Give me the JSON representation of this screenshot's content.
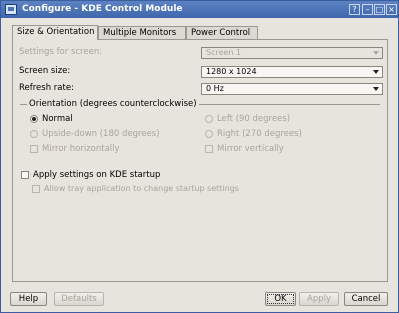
{
  "window": {
    "title": "Configure - KDE Control Module"
  },
  "titlebar_buttons": {
    "help": "?",
    "minimize": "–",
    "maximize": "□",
    "close": "×"
  },
  "tabs": [
    {
      "label": "Size & Orientation"
    },
    {
      "label": "Multiple Monitors"
    },
    {
      "label": "Power Control"
    }
  ],
  "settings": {
    "screen_label": "Settings for screen:",
    "screen_value": "Screen 1",
    "size_label": "Screen size:",
    "size_value": "1280 x 1024",
    "refresh_label": "Refresh rate:",
    "refresh_value": "0 Hz"
  },
  "orientation": {
    "title": "Orientation (degrees counterclockwise)",
    "normal": "Normal",
    "left": "Left (90 degrees)",
    "upside_down": "Upside-down (180 degrees)",
    "right": "Right (270 degrees)",
    "mirror_h": "Mirror horizontally",
    "mirror_v": "Mirror vertically"
  },
  "startup": {
    "apply_label": "Apply settings on KDE startup",
    "tray_label": "Allow tray application to change startup settings"
  },
  "buttons": {
    "help": "Help",
    "defaults": "Defaults",
    "ok": "OK",
    "apply": "Apply",
    "cancel": "Cancel"
  }
}
